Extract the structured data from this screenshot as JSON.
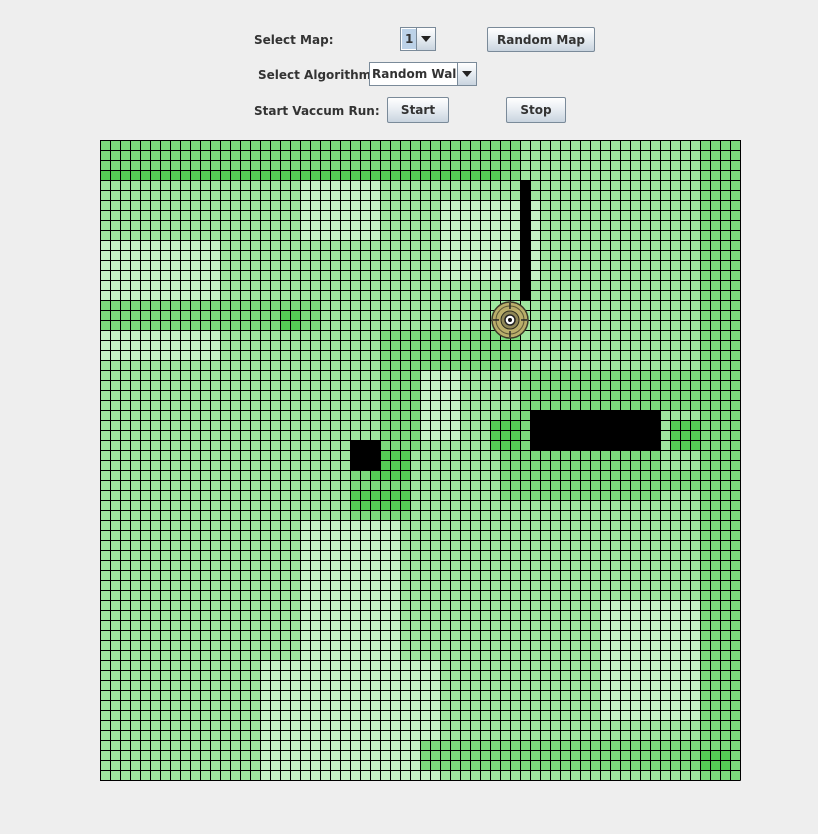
{
  "controls": {
    "select_map_label": "Select Map:",
    "map_value": "1",
    "random_map_label": "Random Map",
    "select_algorithm_label": "Select Algorithm:",
    "algorithm_value": "Random Walk",
    "start_run_label": "Start Vaccum Run:",
    "start_label": "Start",
    "stop_label": "Stop"
  },
  "grid": {
    "rows": 64,
    "cols": 64,
    "robot": {
      "row": 18,
      "col": 41
    },
    "obstacles": [
      {
        "row": 4,
        "col": 42,
        "rows": 12,
        "cols": 1
      },
      {
        "row": 27,
        "col": 43,
        "rows": 4,
        "cols": 13
      },
      {
        "row": 30,
        "col": 25,
        "rows": 3,
        "cols": 3
      }
    ],
    "colors": {
      "base": "#9fe69f",
      "light": "#c4f1c4",
      "medium": "#7cdb7c",
      "dark": "#55cc55",
      "obstacle": "#000000",
      "grid_line": "#000000"
    }
  }
}
